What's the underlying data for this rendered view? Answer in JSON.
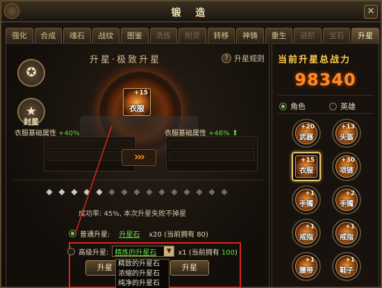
{
  "window": {
    "title": "锻 造",
    "close_label": "✕"
  },
  "tabs": [
    {
      "label": "强化",
      "state": "normal"
    },
    {
      "label": "合成",
      "state": "normal"
    },
    {
      "label": "魂石",
      "state": "normal"
    },
    {
      "label": "战纹",
      "state": "normal"
    },
    {
      "label": "图鉴",
      "state": "normal"
    },
    {
      "label": "洗炼",
      "state": "dim"
    },
    {
      "label": "附灵",
      "state": "dim"
    },
    {
      "label": "转移",
      "state": "normal"
    },
    {
      "label": "神铸",
      "state": "normal"
    },
    {
      "label": "重生",
      "state": "normal"
    },
    {
      "label": "进阶",
      "state": "dim"
    },
    {
      "label": "宝石",
      "state": "dim"
    },
    {
      "label": "升星",
      "state": "active"
    }
  ],
  "left_panel": {
    "side_buttons": [
      {
        "label": "",
        "icon": "star-emblem-icon"
      },
      {
        "label": "封星",
        "icon": "seal-star-icon"
      }
    ],
    "section_title": "升星·极致升星",
    "rules_link": "升星规则",
    "center_item": {
      "name": "衣服",
      "plus": "+15"
    },
    "base_attr_left": {
      "label": "衣服基础属性",
      "pct": "+40%"
    },
    "base_attr_right": {
      "label": "衣服基础属性",
      "pct": "+46%"
    },
    "star_count_lit": 5,
    "star_count_total": 15,
    "info_text": "成功率: 45%, 本次升星失败不掉星",
    "normal_upgrade": {
      "label": "普通升星:",
      "stone": "升星石",
      "qty": "x20 (当前拥有 80)"
    },
    "advanced_upgrade": {
      "label": "高级升星:",
      "selected_stone": "精炼的升星石",
      "qty_prefix": "x1 (当前拥有 ",
      "qty_value": "100",
      "qty_suffix": ")"
    },
    "dropdown_options": [
      "精致的升星石",
      "浓缩的升星石",
      "纯净的升星石"
    ],
    "buttons": {
      "upgrade_left": "升星",
      "upgrade_right": "升星"
    }
  },
  "right_panel": {
    "title": "当前升星总战力",
    "power_value": "98340",
    "radio_role": "角色",
    "radio_hero": "英雄",
    "slots": [
      {
        "name": "武器",
        "plus": "+20",
        "selected": false
      },
      {
        "name": "头盔",
        "plus": "+13",
        "selected": false
      },
      {
        "name": "衣服",
        "plus": "+15",
        "selected": true
      },
      {
        "name": "项链",
        "plus": "+30",
        "selected": false
      },
      {
        "name": "手镯",
        "plus": "+1",
        "selected": false
      },
      {
        "name": "手镯",
        "plus": "+2",
        "selected": false
      },
      {
        "name": "戒指",
        "plus": "+1",
        "selected": false
      },
      {
        "name": "戒指",
        "plus": "+1",
        "selected": false
      },
      {
        "name": "腰带",
        "plus": "+1",
        "selected": false
      },
      {
        "name": "鞋子",
        "plus": "+1",
        "selected": false
      }
    ]
  },
  "colors": {
    "accent_gold": "#ffcc48",
    "power_orange": "#ff8a2a",
    "success_green": "#5ee23c",
    "highlight_red": "#e0241a"
  }
}
